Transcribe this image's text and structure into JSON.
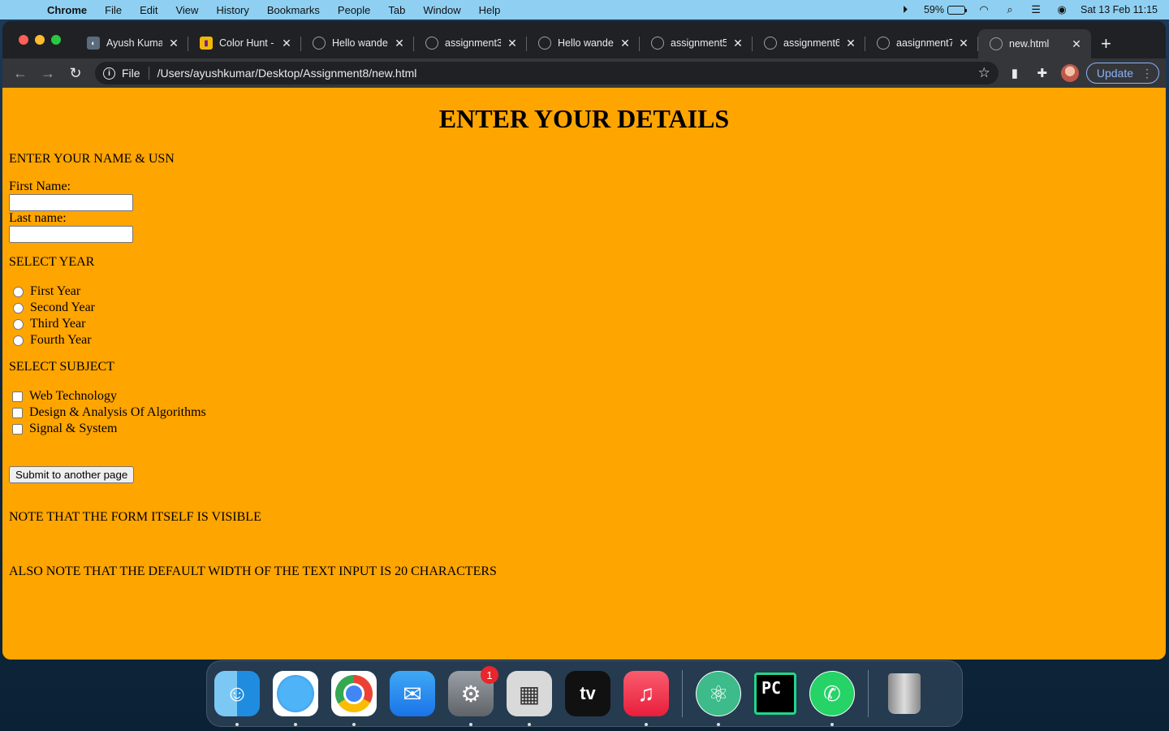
{
  "menubar": {
    "app_name": "Chrome",
    "items": [
      "File",
      "Edit",
      "View",
      "History",
      "Bookmarks",
      "People",
      "Tab",
      "Window",
      "Help"
    ],
    "battery_percent": "59%",
    "battery_level": 0.59,
    "datetime": "Sat 13 Feb  11:15"
  },
  "browser": {
    "tabs": [
      {
        "title": "Ayush Kumar",
        "icon": "profile-image-icon"
      },
      {
        "title": "Color Hunt - ",
        "icon": "color-hunt-icon"
      },
      {
        "title": "Hello wanderer",
        "icon": "globe-icon"
      },
      {
        "title": "assignment3",
        "icon": "globe-icon"
      },
      {
        "title": "Hello wanderer",
        "icon": "globe-icon"
      },
      {
        "title": "assignment5",
        "icon": "globe-icon"
      },
      {
        "title": "assignment6",
        "icon": "globe-icon"
      },
      {
        "title": "aasignment7",
        "icon": "globe-icon"
      },
      {
        "title": "new.html",
        "icon": "globe-icon",
        "active": true
      }
    ],
    "url_scheme": "File",
    "url": "/Users/ayushkumar/Desktop/Assignment8/new.html",
    "update_label": "Update"
  },
  "page": {
    "heading": "ENTER YOUR DETAILS",
    "name_section": "ENTER YOUR NAME & USN",
    "first_name_label": "First Name:",
    "first_name_value": "",
    "last_name_label": "Last name:",
    "last_name_value": "",
    "year_section": "SELECT YEAR",
    "years": [
      "First Year",
      "Second Year",
      "Third Year",
      "Fourth Year"
    ],
    "subject_section": "SELECT SUBJECT",
    "subjects": [
      "Web Technology",
      "Design & Analysis Of Algorithms",
      "Signal & System"
    ],
    "submit_label": "Submit to another page",
    "note1": "NOTE THAT THE FORM ITSELF IS VISIBLE",
    "note2": "ALSO NOTE THAT THE DEFAULT WIDTH OF THE TEXT INPUT IS 20 CHARACTERS",
    "background_color": "#ffa500"
  },
  "dock": {
    "apps": [
      "finder-icon",
      "safari-icon",
      "chrome-icon",
      "mail-icon",
      "system-preferences-icon",
      "calculator-icon",
      "apple-tv-icon",
      "music-icon",
      "atom-icon",
      "pycharm-icon",
      "whatsapp-icon",
      "trash-icon"
    ],
    "tv_label": "tv",
    "pycharm_label": "PC",
    "prefs_badge": "1"
  }
}
